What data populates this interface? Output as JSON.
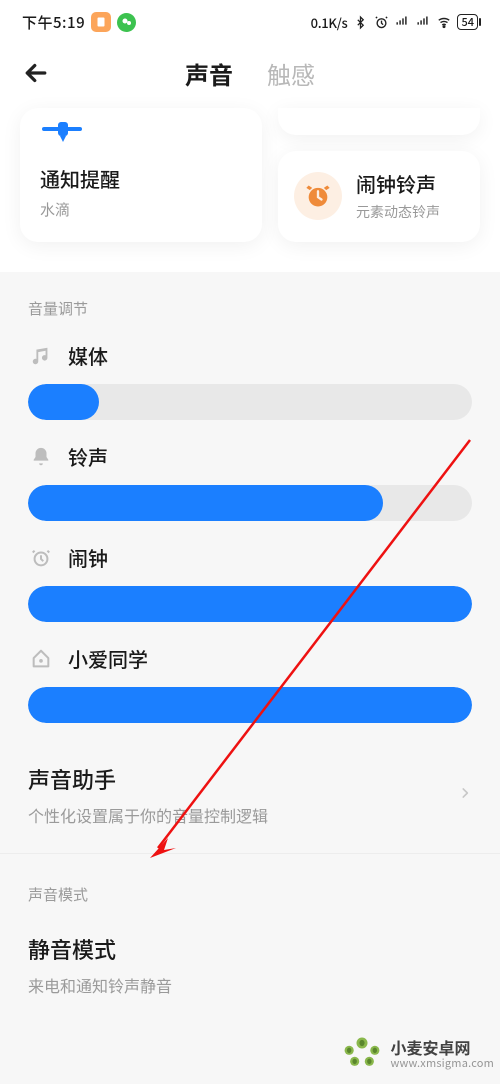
{
  "status": {
    "time": "下午5:19",
    "net": "0.1K/s",
    "battery": "54"
  },
  "header": {
    "tab_sound": "声音",
    "tab_haptic": "触感"
  },
  "cards": {
    "notify": {
      "title": "通知提醒",
      "subtitle": "水滴"
    },
    "alarm": {
      "title": "闹钟铃声",
      "subtitle": "元素动态铃声"
    }
  },
  "sections": {
    "volume_heading": "音量调节",
    "sound_mode_heading": "声音模式"
  },
  "sliders": {
    "media": {
      "label": "媒体",
      "value": 16
    },
    "ring": {
      "label": "铃声",
      "value": 80
    },
    "alarm": {
      "label": "闹钟",
      "value": 100
    },
    "xiaoai": {
      "label": "小爱同学",
      "value": 100
    }
  },
  "assistant": {
    "title": "声音助手",
    "subtitle": "个性化设置属于你的音量控制逻辑"
  },
  "silent": {
    "title": "静音模式",
    "subtitle": "来电和通知铃声静音"
  },
  "watermark": {
    "cn": "小麦安卓网",
    "en": "www.xmsigma.com"
  },
  "colors": {
    "accent": "#1b7fff"
  }
}
